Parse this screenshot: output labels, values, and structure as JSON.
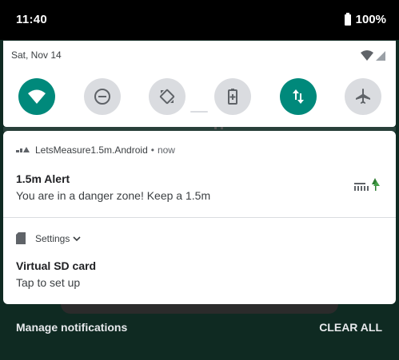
{
  "status_bar": {
    "time": "11:40",
    "battery": "100%"
  },
  "quick_settings": {
    "date": "Sat, Nov 14",
    "tiles": [
      {
        "icon": "wifi-icon",
        "active": true
      },
      {
        "icon": "do-not-disturb-icon",
        "active": false
      },
      {
        "icon": "auto-rotate-icon",
        "active": false
      },
      {
        "icon": "battery-saver-icon",
        "active": false
      },
      {
        "icon": "mobile-data-icon",
        "active": true
      },
      {
        "icon": "airplane-mode-icon",
        "active": false
      }
    ],
    "accent_color": "#00897b"
  },
  "notifications": [
    {
      "app": "LetsMeasure1.5m.Android",
      "separator": "•",
      "time": "now",
      "title": "1.5m Alert",
      "text": "You are in a danger zone! Keep a 1.5m"
    },
    {
      "app": "Settings",
      "title": "Virtual SD card",
      "text": "Tap to set up"
    }
  ],
  "footer": {
    "manage": "Manage notifications",
    "clear": "CLEAR ALL"
  }
}
